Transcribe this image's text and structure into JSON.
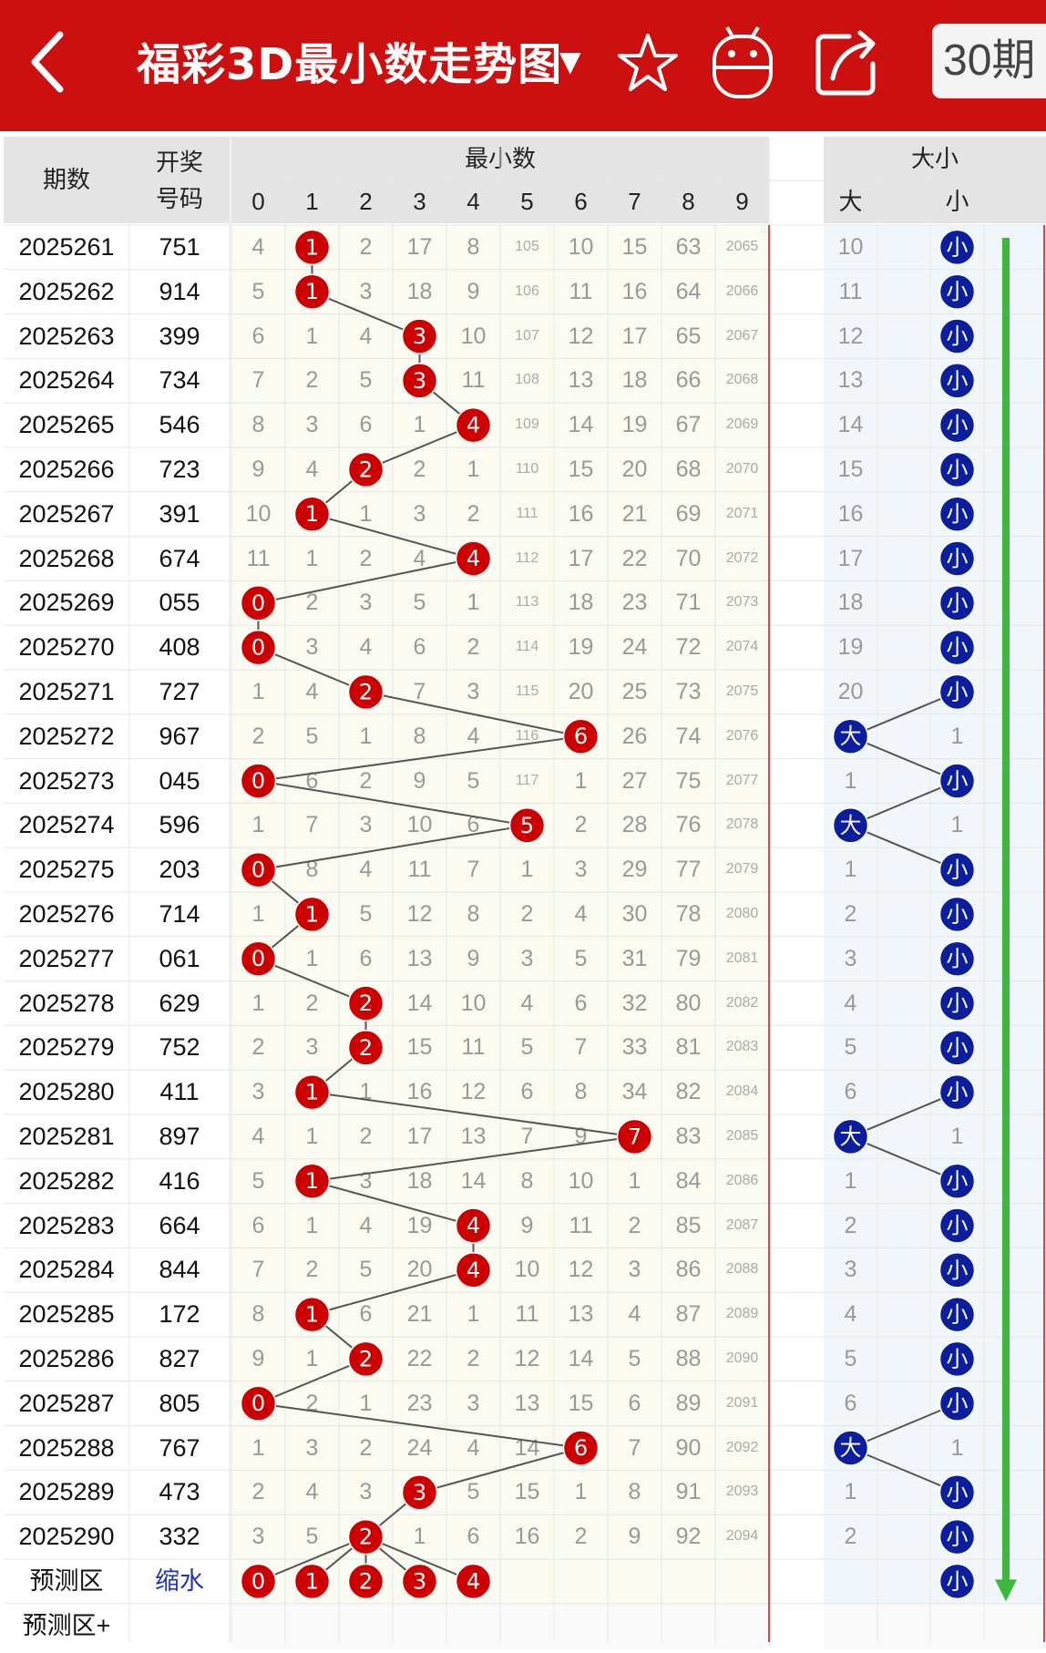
{
  "header": {
    "title": "福彩3D最小数走势图",
    "dropdown_icon": "triangle-down-icon",
    "back_icon": "chevron-left-icon",
    "favorite_icon": "star-icon",
    "android_icon": "android-icon",
    "share_icon": "share-icon",
    "period_label": "30期",
    "bg_color": "#cc1010"
  },
  "table": {
    "col_issue": "期数",
    "col_draw_line1": "开奖",
    "col_draw_line2": "号码",
    "group_min": "最小数",
    "group_size": "大小",
    "digits": [
      "0",
      "1",
      "2",
      "3",
      "4",
      "5",
      "6",
      "7",
      "8",
      "9"
    ],
    "size_big": "大",
    "size_small": "小",
    "rows": [
      {
        "issue": "2025261",
        "draw": "751",
        "min": 1,
        "cells": [
          "4",
          "1",
          "2",
          "17",
          "8",
          "105",
          "10",
          "15",
          "63",
          "2065"
        ],
        "size": "小",
        "big_miss": "10"
      },
      {
        "issue": "2025262",
        "draw": "914",
        "min": 1,
        "cells": [
          "5",
          "1",
          "3",
          "18",
          "9",
          "106",
          "11",
          "16",
          "64",
          "2066"
        ],
        "size": "小",
        "big_miss": "11"
      },
      {
        "issue": "2025263",
        "draw": "399",
        "min": 3,
        "cells": [
          "6",
          "1",
          "4",
          "3",
          "10",
          "107",
          "12",
          "17",
          "65",
          "2067"
        ],
        "size": "小",
        "big_miss": "12"
      },
      {
        "issue": "2025264",
        "draw": "734",
        "min": 3,
        "cells": [
          "7",
          "2",
          "5",
          "3",
          "11",
          "108",
          "13",
          "18",
          "66",
          "2068"
        ],
        "size": "小",
        "big_miss": "13"
      },
      {
        "issue": "2025265",
        "draw": "546",
        "min": 4,
        "cells": [
          "8",
          "3",
          "6",
          "1",
          "4",
          "109",
          "14",
          "19",
          "67",
          "2069"
        ],
        "size": "小",
        "big_miss": "14"
      },
      {
        "issue": "2025266",
        "draw": "723",
        "min": 2,
        "cells": [
          "9",
          "4",
          "2",
          "2",
          "1",
          "110",
          "15",
          "20",
          "68",
          "2070"
        ],
        "size": "小",
        "big_miss": "15"
      },
      {
        "issue": "2025267",
        "draw": "391",
        "min": 1,
        "cells": [
          "10",
          "1",
          "1",
          "3",
          "2",
          "111",
          "16",
          "21",
          "69",
          "2071"
        ],
        "size": "小",
        "big_miss": "16"
      },
      {
        "issue": "2025268",
        "draw": "674",
        "min": 4,
        "cells": [
          "11",
          "1",
          "2",
          "4",
          "4",
          "112",
          "17",
          "22",
          "70",
          "2072"
        ],
        "size": "小",
        "big_miss": "17"
      },
      {
        "issue": "2025269",
        "draw": "055",
        "min": 0,
        "cells": [
          "0",
          "2",
          "3",
          "5",
          "1",
          "113",
          "18",
          "23",
          "71",
          "2073"
        ],
        "size": "小",
        "big_miss": "18"
      },
      {
        "issue": "2025270",
        "draw": "408",
        "min": 0,
        "cells": [
          "0",
          "3",
          "4",
          "6",
          "2",
          "114",
          "19",
          "24",
          "72",
          "2074"
        ],
        "size": "小",
        "big_miss": "19"
      },
      {
        "issue": "2025271",
        "draw": "727",
        "min": 2,
        "cells": [
          "1",
          "4",
          "2",
          "7",
          "3",
          "115",
          "20",
          "25",
          "73",
          "2075"
        ],
        "size": "小",
        "big_miss": "20"
      },
      {
        "issue": "2025272",
        "draw": "967",
        "min": 6,
        "cells": [
          "2",
          "5",
          "1",
          "8",
          "4",
          "116",
          "6",
          "26",
          "74",
          "2076"
        ],
        "size": "大",
        "small_miss": "1"
      },
      {
        "issue": "2025273",
        "draw": "045",
        "min": 0,
        "cells": [
          "0",
          "6",
          "2",
          "9",
          "5",
          "117",
          "1",
          "27",
          "75",
          "2077"
        ],
        "size": "小",
        "big_miss": "1"
      },
      {
        "issue": "2025274",
        "draw": "596",
        "min": 5,
        "cells": [
          "1",
          "7",
          "3",
          "10",
          "6",
          "5",
          "2",
          "28",
          "76",
          "2078"
        ],
        "size": "大",
        "small_miss": "1"
      },
      {
        "issue": "2025275",
        "draw": "203",
        "min": 0,
        "cells": [
          "0",
          "8",
          "4",
          "11",
          "7",
          "1",
          "3",
          "29",
          "77",
          "2079"
        ],
        "size": "小",
        "big_miss": "1"
      },
      {
        "issue": "2025276",
        "draw": "714",
        "min": 1,
        "cells": [
          "1",
          "1",
          "5",
          "12",
          "8",
          "2",
          "4",
          "30",
          "78",
          "2080"
        ],
        "size": "小",
        "big_miss": "2"
      },
      {
        "issue": "2025277",
        "draw": "061",
        "min": 0,
        "cells": [
          "0",
          "1",
          "6",
          "13",
          "9",
          "3",
          "5",
          "31",
          "79",
          "2081"
        ],
        "size": "小",
        "big_miss": "3"
      },
      {
        "issue": "2025278",
        "draw": "629",
        "min": 2,
        "cells": [
          "1",
          "2",
          "2",
          "14",
          "10",
          "4",
          "6",
          "32",
          "80",
          "2082"
        ],
        "size": "小",
        "big_miss": "4"
      },
      {
        "issue": "2025279",
        "draw": "752",
        "min": 2,
        "cells": [
          "2",
          "3",
          "2",
          "15",
          "11",
          "5",
          "7",
          "33",
          "81",
          "2083"
        ],
        "size": "小",
        "big_miss": "5"
      },
      {
        "issue": "2025280",
        "draw": "411",
        "min": 1,
        "cells": [
          "3",
          "1",
          "1",
          "16",
          "12",
          "6",
          "8",
          "34",
          "82",
          "2084"
        ],
        "size": "小",
        "big_miss": "6"
      },
      {
        "issue": "2025281",
        "draw": "897",
        "min": 7,
        "cells": [
          "4",
          "1",
          "2",
          "17",
          "13",
          "7",
          "9",
          "7",
          "83",
          "2085"
        ],
        "size": "大",
        "small_miss": "1"
      },
      {
        "issue": "2025282",
        "draw": "416",
        "min": 1,
        "cells": [
          "5",
          "1",
          "3",
          "18",
          "14",
          "8",
          "10",
          "1",
          "84",
          "2086"
        ],
        "size": "小",
        "big_miss": "1"
      },
      {
        "issue": "2025283",
        "draw": "664",
        "min": 4,
        "cells": [
          "6",
          "1",
          "4",
          "19",
          "4",
          "9",
          "11",
          "2",
          "85",
          "2087"
        ],
        "size": "小",
        "big_miss": "2"
      },
      {
        "issue": "2025284",
        "draw": "844",
        "min": 4,
        "cells": [
          "7",
          "2",
          "5",
          "20",
          "4",
          "10",
          "12",
          "3",
          "86",
          "2088"
        ],
        "size": "小",
        "big_miss": "3"
      },
      {
        "issue": "2025285",
        "draw": "172",
        "min": 1,
        "cells": [
          "8",
          "1",
          "6",
          "21",
          "1",
          "11",
          "13",
          "4",
          "87",
          "2089"
        ],
        "size": "小",
        "big_miss": "4"
      },
      {
        "issue": "2025286",
        "draw": "827",
        "min": 2,
        "cells": [
          "9",
          "1",
          "2",
          "22",
          "2",
          "12",
          "14",
          "5",
          "88",
          "2090"
        ],
        "size": "小",
        "big_miss": "5"
      },
      {
        "issue": "2025287",
        "draw": "805",
        "min": 0,
        "cells": [
          "0",
          "2",
          "1",
          "23",
          "3",
          "13",
          "15",
          "6",
          "89",
          "2091"
        ],
        "size": "小",
        "big_miss": "6"
      },
      {
        "issue": "2025288",
        "draw": "767",
        "min": 6,
        "cells": [
          "1",
          "3",
          "2",
          "24",
          "4",
          "14",
          "6",
          "7",
          "90",
          "2092"
        ],
        "size": "大",
        "small_miss": "1"
      },
      {
        "issue": "2025289",
        "draw": "473",
        "min": 3,
        "cells": [
          "2",
          "4",
          "3",
          "3",
          "5",
          "15",
          "1",
          "8",
          "91",
          "2093"
        ],
        "size": "小",
        "big_miss": "1"
      },
      {
        "issue": "2025290",
        "draw": "332",
        "min": 2,
        "cells": [
          "3",
          "5",
          "2",
          "1",
          "6",
          "16",
          "2",
          "9",
          "92",
          "2094"
        ],
        "size": "小",
        "big_miss": "2"
      }
    ],
    "predict": {
      "label": "预测区",
      "draw_link": "缩水",
      "digits": [
        "0",
        "1",
        "2",
        "3",
        "4"
      ],
      "size": "小"
    },
    "predict_plus_label": "预测区+",
    "colors": {
      "red_ball": "#cc0000",
      "blue_ball": "#0a1e9e",
      "arrow": "#3cb83c",
      "header_gray": "#e4e4e4",
      "cream": "#fbfbf2",
      "light_blue": "#f1f6fb"
    }
  }
}
